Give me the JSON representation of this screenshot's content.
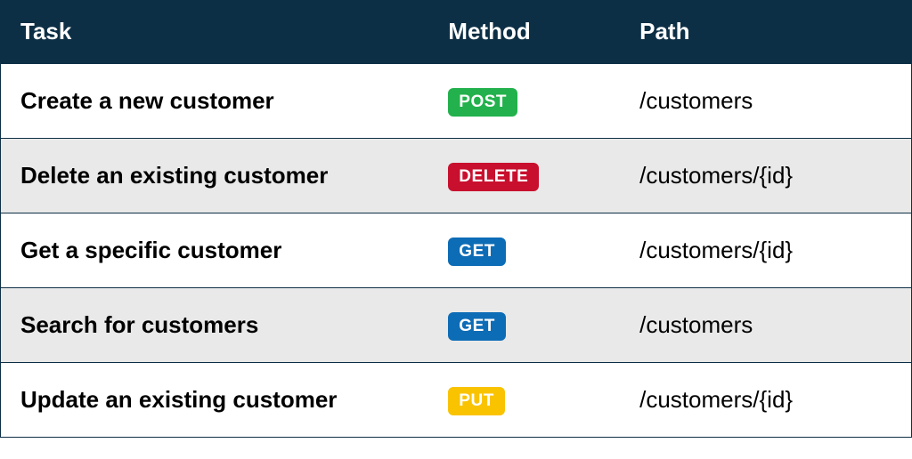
{
  "headers": {
    "task": "Task",
    "method": "Method",
    "path": "Path"
  },
  "rows": [
    {
      "task": "Create a new customer",
      "method": "POST",
      "path": "/customers"
    },
    {
      "task": "Delete an existing customer",
      "method": "DELETE",
      "path": "/customers/{id}"
    },
    {
      "task": "Get a specific customer",
      "method": "GET",
      "path": "/customers/{id}"
    },
    {
      "task": "Search for customers",
      "method": "GET",
      "path": "/customers"
    },
    {
      "task": "Update an existing customer",
      "method": "PUT",
      "path": "/customers/{id}"
    }
  ]
}
